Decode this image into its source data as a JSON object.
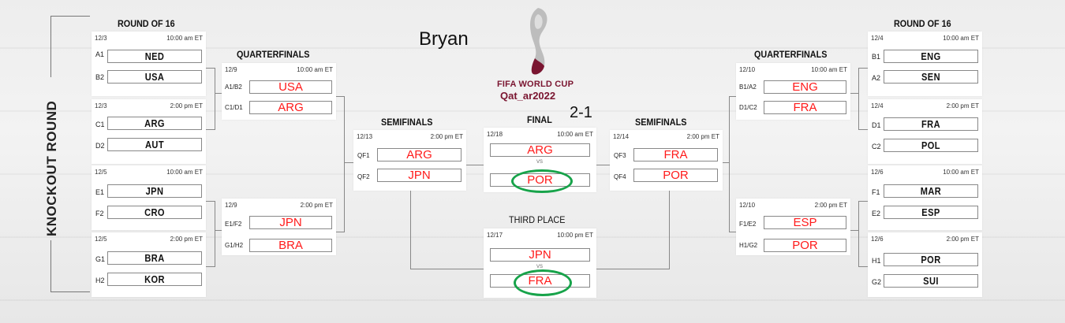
{
  "annotation": {
    "name": "Bryan",
    "score": "2-1"
  },
  "sidebar_label": "KNOCKOUT ROUND",
  "logo": {
    "line1": "FIFA WORLD CUP",
    "line2": "Qat_ar2022"
  },
  "titles": {
    "r16_left": "ROUND OF 16",
    "qf_left": "QUARTERFINALS",
    "sf_left": "SEMIFINALS",
    "final": "FINAL",
    "third": "THIRD PLACE",
    "sf_right": "SEMIFINALS",
    "qf_right": "QUARTERFINALS",
    "r16_right": "ROUND OF 16"
  },
  "vs": "VS",
  "r16_left": [
    {
      "date": "12/3",
      "time": "10:00 am ET",
      "s1": "A1",
      "t1": "NED",
      "s2": "B2",
      "t2": "USA"
    },
    {
      "date": "12/3",
      "time": "2:00 pm ET",
      "s1": "C1",
      "t1": "ARG",
      "s2": "D2",
      "t2": "AUT"
    },
    {
      "date": "12/5",
      "time": "10:00 am ET",
      "s1": "E1",
      "t1": "JPN",
      "s2": "F2",
      "t2": "CRO"
    },
    {
      "date": "12/5",
      "time": "2:00 pm ET",
      "s1": "G1",
      "t1": "BRA",
      "s2": "H2",
      "t2": "KOR"
    }
  ],
  "qf_left": [
    {
      "date": "12/9",
      "time": "10:00 am ET",
      "s1": "A1/B2",
      "t1": "USA",
      "s2": "C1/D1",
      "t2": "ARG"
    },
    {
      "date": "12/9",
      "time": "2:00 pm ET",
      "s1": "E1/F2",
      "t1": "JPN",
      "s2": "G1/H2",
      "t2": "BRA"
    }
  ],
  "sf_left": {
    "date": "12/13",
    "time": "2:00 pm ET",
    "s1": "QF1",
    "t1": "ARG",
    "s2": "QF2",
    "t2": "JPN"
  },
  "final": {
    "date": "12/18",
    "time": "10:00 am ET",
    "t1": "ARG",
    "t2": "POR"
  },
  "third": {
    "date": "12/17",
    "time": "10:00 pm ET",
    "t1": "JPN",
    "t2": "FRA"
  },
  "sf_right": {
    "date": "12/14",
    "time": "2:00 pm ET",
    "s1": "QF3",
    "t1": "FRA",
    "s2": "QF4",
    "t2": "POR"
  },
  "qf_right": [
    {
      "date": "12/10",
      "time": "10:00 am ET",
      "s1": "B1/A2",
      "t1": "ENG",
      "s2": "D1/C2",
      "t2": "FRA"
    },
    {
      "date": "12/10",
      "time": "2:00 pm ET",
      "s1": "F1/E2",
      "t1": "ESP",
      "s2": "H1/G2",
      "t2": "POR"
    }
  ],
  "r16_right": [
    {
      "date": "12/4",
      "time": "10:00 am ET",
      "s1": "B1",
      "t1": "ENG",
      "s2": "A2",
      "t2": "SEN"
    },
    {
      "date": "12/4",
      "time": "2:00 pm ET",
      "s1": "D1",
      "t1": "FRA",
      "s2": "C2",
      "t2": "POL"
    },
    {
      "date": "12/6",
      "time": "10:00 am ET",
      "s1": "F1",
      "t1": "MAR",
      "s2": "E2",
      "t2": "ESP"
    },
    {
      "date": "12/6",
      "time": "2:00 pm ET",
      "s1": "H1",
      "t1": "POR",
      "s2": "G2",
      "t2": "SUI"
    }
  ],
  "colors": {
    "winner_text": "#ff1a1a",
    "circle": "#17a34a",
    "logo": "#7a1530"
  }
}
